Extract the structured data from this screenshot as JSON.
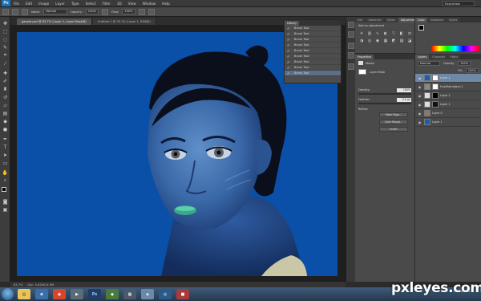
{
  "colors": {
    "accent": "#1f6fb5",
    "canvas_bg": "#0a50a8",
    "selected_layer": "#6e88a8"
  },
  "app": {
    "logo": "Ps"
  },
  "menu": {
    "items": [
      "File",
      "Edit",
      "Image",
      "Layer",
      "Type",
      "Select",
      "Filter",
      "3D",
      "View",
      "Window",
      "Help"
    ],
    "workspace": "Essentials"
  },
  "options": {
    "brush_label": "Brush:",
    "mode_label": "Mode:",
    "mode_value": "Normal",
    "opacity_label": "Opacity:",
    "opacity_value": "100%",
    "flow_label": "Flow:",
    "flow_value": "100%"
  },
  "tabs": [
    "gansta.psd @ 63.7% (Layer 1, Layer Mask/8)",
    "Untitled-1 @ 76.1% (Layer 1, RGB/8)"
  ],
  "history": {
    "items": [
      "Brush Tool",
      "Brush Tool",
      "Brush Tool",
      "Brush Tool",
      "Brush Tool",
      "Brush Tool",
      "Brush Tool",
      "Brush Tool",
      "Brush Tool"
    ]
  },
  "adjustments": {
    "tabs": [
      "Info",
      "Swatches",
      "Styles",
      "Adjustments"
    ],
    "title": "Add an adjustment"
  },
  "properties": {
    "tab": "Properties",
    "section": "Masks",
    "mask_label": "Layer Mask",
    "density_label": "Density:",
    "density_value": "100%",
    "feather_label": "Feather:",
    "feather_value": "0.0 px",
    "refine_label": "Refine:",
    "btn_mask_edge": "Mask Edge...",
    "btn_color_range": "Color Range...",
    "btn_invert": "Invert"
  },
  "color_panel": {
    "tabs": [
      "Color",
      "Swatches",
      "Styles"
    ]
  },
  "layers": {
    "tabs": [
      "Layers",
      "Channels",
      "Paths"
    ],
    "blend_mode": "Normal",
    "opacity": "100%",
    "fill": "100%",
    "items": [
      "Layer 1",
      "Hue/Saturation 1",
      "Layer 2",
      "Layer 1",
      "Layer 0",
      "Layer 1"
    ]
  },
  "status": {
    "zoom": "63.7%",
    "doc": "Doc: 5.62M/14.9M"
  },
  "taskbar": {
    "time": "",
    "date": "05/06/2012"
  },
  "watermark": "pxleyes.com"
}
